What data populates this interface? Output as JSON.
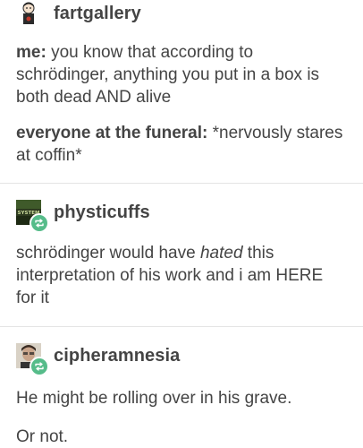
{
  "posts": [
    {
      "username": "fartgallery",
      "paragraphs": [
        {
          "speaker": "me:",
          "text": " you know that according to schrödinger, anything you put in a box is both dead AND alive"
        },
        {
          "speaker": "everyone at the funeral:",
          "text": " *nervously stares at coffin*"
        }
      ]
    },
    {
      "username": "physticuffs",
      "avatar_text": "SYSTEM",
      "body_before": "schrödinger would have ",
      "body_em": "hated",
      "body_after": " this interpretation of his work and i am HERE for it"
    },
    {
      "username": "cipheramnesia",
      "lines": [
        "He might be rolling over in his grave.",
        "Or not."
      ]
    }
  ],
  "colors": {
    "text": "#444444",
    "reblog_badge": "#56bc8a",
    "divider": "#e4e4e4"
  },
  "icons": [
    "reblog-icon"
  ]
}
